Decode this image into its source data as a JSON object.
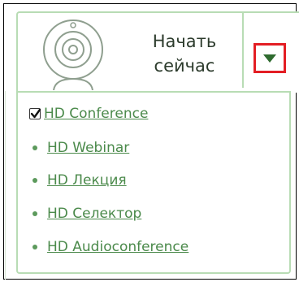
{
  "start_panel": {
    "label_line1": "Начать",
    "label_line2": "сейчас",
    "icon": "webcam-icon",
    "dropdown_icon": "triangle-down-icon"
  },
  "menu": {
    "items": [
      {
        "label": "HD Conference",
        "checked": true
      },
      {
        "label": "HD Webinar",
        "checked": false
      },
      {
        "label": "HD Лекция",
        "checked": false
      },
      {
        "label": "HD Селектор",
        "checked": false
      },
      {
        "label": "HD Audioconference",
        "checked": false
      }
    ]
  },
  "colors": {
    "accent_green": "#4b8a4b",
    "panel_border": "#b8dcb4",
    "highlight_red": "#e31e24"
  }
}
